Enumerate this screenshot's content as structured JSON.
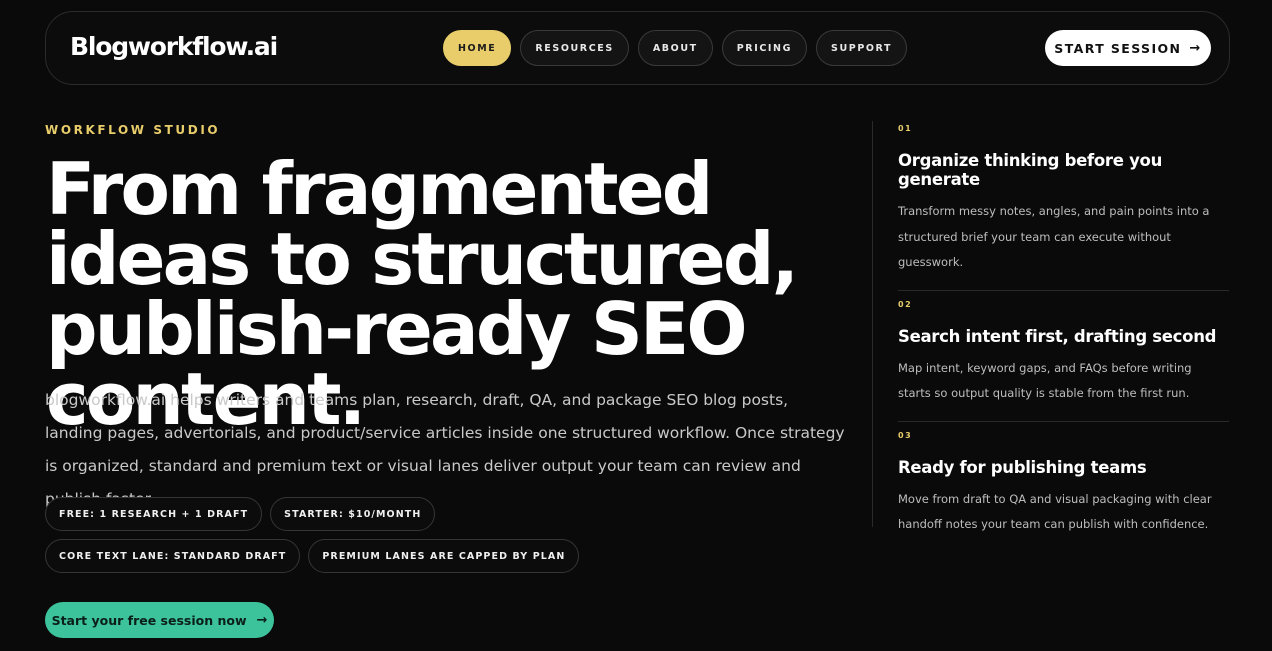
{
  "nav": {
    "logo": "Blogworkflow.ai",
    "links": [
      {
        "label": "HOME",
        "active": true
      },
      {
        "label": "RESOURCES",
        "active": false
      },
      {
        "label": "ABOUT",
        "active": false
      },
      {
        "label": "PRICING",
        "active": false
      },
      {
        "label": "SUPPORT",
        "active": false
      }
    ],
    "cta": "START SESSION",
    "cta_icon": "→"
  },
  "hero": {
    "eyebrow": "WORKFLOW STUDIO",
    "headline": "From fragmented ideas to structured, publish-ready SEO content.",
    "lede": "blogworkflow.ai helps writers and teams plan, research, draft, QA, and package SEO blog posts, landing pages, advertorials, and product/service articles inside one structured workflow. Once strategy is organized, standard and premium text or visual lanes deliver output your team can review and publish faster.",
    "chips": [
      "FREE: 1 RESEARCH + 1 DRAFT",
      "STARTER: $10/MONTH",
      "CORE TEXT LANE: STANDARD DRAFT",
      "PREMIUM LANES ARE CAPPED BY PLAN"
    ],
    "cta": "Start your free session now",
    "cta_icon": "→"
  },
  "steps": [
    {
      "num": "01",
      "title": "Organize thinking before you generate",
      "body": "Transform messy notes, angles, and pain points into a structured brief your team can execute without guesswork."
    },
    {
      "num": "02",
      "title": "Search intent first, drafting second",
      "body": "Map intent, keyword gaps, and FAQs before writing starts so output quality is stable from the first run."
    },
    {
      "num": "03",
      "title": "Ready for publishing teams",
      "body": "Move from draft to QA and visual packaging with clear handoff notes your team can publish with confidence."
    }
  ],
  "colors": {
    "accent_gold": "#e8cd6a",
    "accent_green": "#3dc39c",
    "background": "#0a0a0a"
  }
}
